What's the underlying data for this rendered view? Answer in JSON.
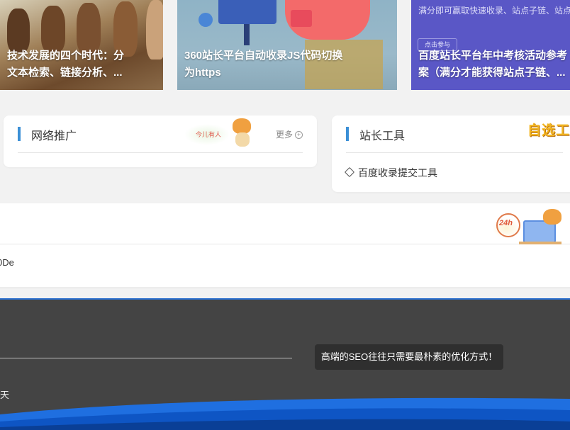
{
  "cards": [
    {
      "title_line1": "技术发展的四个时代：分",
      "title_line2": "文本检索、链接分析、..."
    },
    {
      "title_line1": "360站长平台自动收录JS代码切换",
      "title_line2": "为https"
    },
    {
      "top_text": "满分即可赢取快速收录、站点子链、站点",
      "button_label": "点击参与",
      "title_line1": "百度站长平台年中考核活动参考",
      "title_line2": "案（满分才能获得站点子链、..."
    }
  ],
  "panels": {
    "network": {
      "title": "网络推广",
      "more_label": "更多",
      "more_icon": "plus-circle-icon",
      "mascot_text": "今儿有人"
    },
    "tools": {
      "title": "站长工具",
      "mascot_text": "自选工具",
      "items": [
        {
          "icon": "tag-icon",
          "label": "百度收录提交工具"
        }
      ]
    },
    "bottom": {
      "row_text": "0De",
      "badge": "24h"
    }
  },
  "footer": {
    "tooltip": "高端的SEO往往只需要最朴素的优化方式！",
    "side_text": "天"
  },
  "colors": {
    "accent": "#3b8fd6",
    "footer_bg": "#444444",
    "footer_wave": "#1f6fe0",
    "card3_bg": "#5a57c6"
  }
}
